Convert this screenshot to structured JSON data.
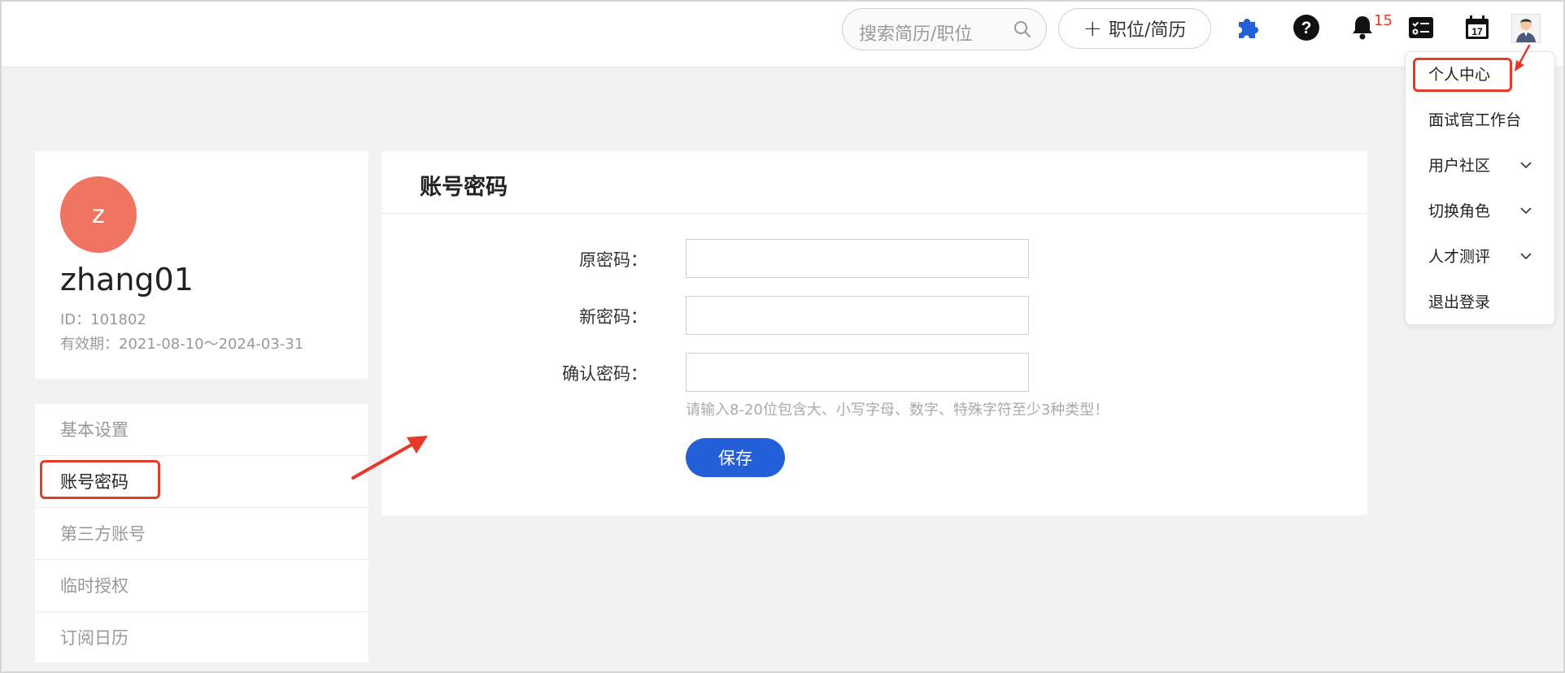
{
  "header": {
    "search_placeholder": "搜索简历/职位",
    "add_button_label": "职位/简历",
    "notification_count": "15",
    "icons": [
      "plugin-icon",
      "help-icon",
      "bell-icon",
      "tasks-icon",
      "calendar-icon",
      "user-avatar-icon"
    ]
  },
  "profile": {
    "initial": "z",
    "username": "zhang01",
    "id_text": "ID：101802",
    "validity_text": "有效期：2021-08-10～2024-03-31",
    "avatar_color": "#f07462"
  },
  "sidebar": {
    "items": [
      {
        "label": "基本设置"
      },
      {
        "label": "账号密码"
      },
      {
        "label": "第三方账号"
      },
      {
        "label": "临时授权"
      },
      {
        "label": "订阅日历"
      }
    ]
  },
  "main": {
    "title": "账号密码",
    "fields": [
      {
        "label": "原密码："
      },
      {
        "label": "新密码："
      },
      {
        "label": "确认密码："
      }
    ],
    "hint": "请输入8-20位包含大、小写字母、数字、特殊字符至少3种类型！",
    "save_label": "保存"
  },
  "dropdown": {
    "items": [
      {
        "label": "个人中心"
      },
      {
        "label": "面试官工作台"
      },
      {
        "label": "用户社区"
      },
      {
        "label": "切换角色"
      },
      {
        "label": "人才测评"
      },
      {
        "label": "退出登录"
      }
    ]
  },
  "colors": {
    "accent": "#2360d8",
    "highlight": "#e53a27",
    "plugin_icon": "#2360d8"
  }
}
